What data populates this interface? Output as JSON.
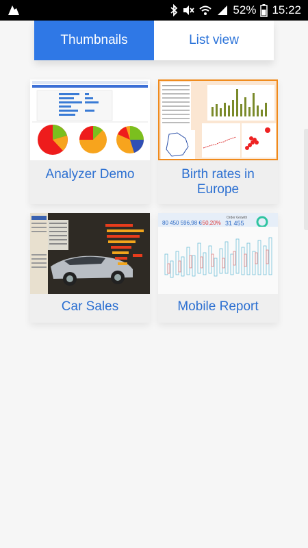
{
  "status_bar": {
    "battery_percent": "52%",
    "time": "15:22",
    "icons": [
      "app-icon",
      "bluetooth-icon",
      "mute-icon",
      "wifi-icon",
      "signal-icon",
      "battery-icon"
    ]
  },
  "tabs": [
    {
      "label": "Thumbnails",
      "active": true
    },
    {
      "label": "List view",
      "active": false
    }
  ],
  "cards": [
    {
      "title": "Analyzer Demo",
      "thumbnail": "analyzer-demo-thumbnail"
    },
    {
      "title": "Birth rates in Europe",
      "thumbnail": "birth-rates-thumbnail"
    },
    {
      "title": "Car Sales",
      "thumbnail": "car-sales-thumbnail"
    },
    {
      "title": "Mobile Report",
      "thumbnail": "mobile-report-thumbnail"
    }
  ],
  "mobile_report_thumb": {
    "kpi_value": "80 450 596,98 €",
    "kpi_change": "-50,20%",
    "order_growth_label": "Order Growth",
    "order_growth_value": "31 455"
  },
  "colors": {
    "accent": "#2f78e6",
    "link": "#2b6fd1",
    "card_bg": "#efefef",
    "page_bg": "#f6f6f6"
  }
}
